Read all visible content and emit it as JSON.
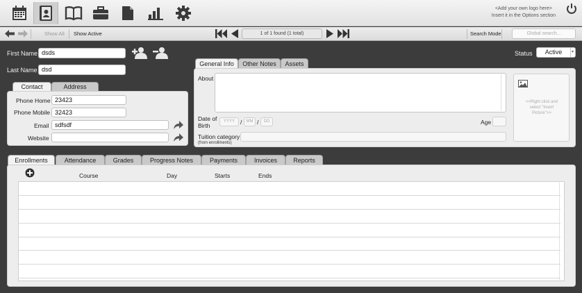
{
  "toolbar": {
    "icons": [
      "calendar-icon",
      "contacts-icon",
      "book-icon",
      "briefcase-icon",
      "document-icon",
      "bar-chart-icon",
      "gear-icon"
    ],
    "logo_line1": "<Add your own logo here>",
    "logo_line2": "Insert it in the Options section"
  },
  "nav": {
    "show_all": "Show All",
    "show_active": "Show Active",
    "found_text": "1 of 1 found (1 total)",
    "search_mode": "Search Mode",
    "global_search_placeholder": "Global search..."
  },
  "person": {
    "first_name_label": "First Name",
    "first_name": "dsds",
    "last_name_label": "Last Name",
    "last_name": "dsd",
    "status_label": "Status",
    "status_value": "Active"
  },
  "contact_tabs": [
    "Contact",
    "Address"
  ],
  "contact": {
    "phone_home_label": "Phone Home",
    "phone_home": "23423",
    "phone_mobile_label": "Phone Mobile",
    "phone_mobile": "32423",
    "email_label": "Email",
    "email": "sdfsdf",
    "website_label": "Website",
    "website": ""
  },
  "info_tabs": [
    "General Info",
    "Other Notes",
    "Assets"
  ],
  "general": {
    "about_label": "About",
    "dob_label_1": "Date of",
    "dob_label_2": "Birth",
    "dob_year_placeholder": "YYYY",
    "dob_month_placeholder": "MM",
    "dob_day_placeholder": "DD",
    "slash": "/",
    "age_label": "Age",
    "tuition_label": "Tuition category",
    "tuition_sub": "(from enrollments)",
    "picture_hint": "<<Right click and select \"Insert Picture\">>"
  },
  "bottom_tabs": [
    "Enrollments",
    "Attendance",
    "Grades",
    "Progress Notes",
    "Payments",
    "Invoices",
    "Reports"
  ],
  "enrollments": {
    "columns": [
      "Course",
      "Day",
      "Starts",
      "Ends"
    ]
  }
}
